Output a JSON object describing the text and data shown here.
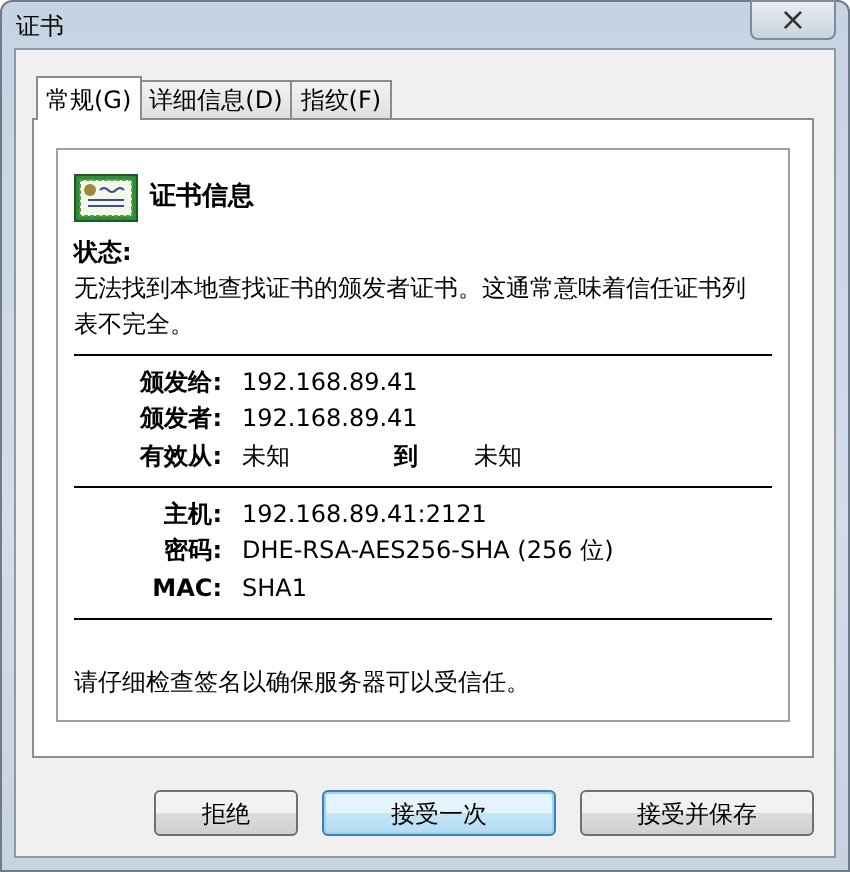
{
  "window": {
    "title": "证书",
    "close": "×"
  },
  "tabs": [
    {
      "label": "常规(G)",
      "selected": true
    },
    {
      "label": "详细信息(D)",
      "selected": false
    },
    {
      "label": "指纹(F)",
      "selected": false
    }
  ],
  "heading": "证书信息",
  "status": {
    "label": "状态:",
    "text": "无法找到本地查找证书的颁发者证书。这通常意味着信任证书列表不完全。"
  },
  "issue": [
    {
      "label": "颁发给:",
      "value": "192.168.89.41"
    },
    {
      "label": "颁发者:",
      "value": "192.168.89.41"
    }
  ],
  "validity": {
    "label": "有效从:",
    "from": "未知",
    "to_label": "到",
    "to": "未知"
  },
  "connection": [
    {
      "label": "主机:",
      "value": "192.168.89.41:2121"
    },
    {
      "label": "密码:",
      "value": "DHE-RSA-AES256-SHA (256 位)"
    },
    {
      "label": "MAC:",
      "value": "SHA1"
    }
  ],
  "note": "请仔细检查签名以确保服务器可以受信任。",
  "buttons": [
    {
      "label": "拒绝",
      "default": false
    },
    {
      "label": "接受一次",
      "default": true
    },
    {
      "label": "接受并保存",
      "default": false
    }
  ]
}
